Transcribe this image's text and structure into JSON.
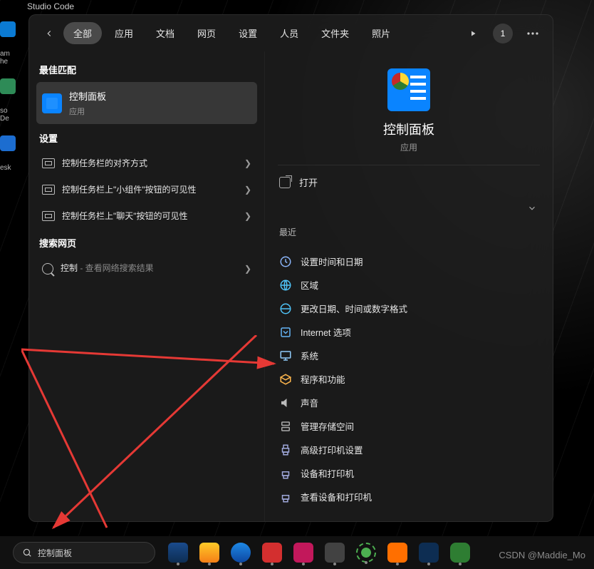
{
  "desktop": {
    "studio_code": "Studio Code"
  },
  "header": {
    "tabs": [
      "全部",
      "应用",
      "文档",
      "网页",
      "设置",
      "人员",
      "文件夹",
      "照片"
    ],
    "badge": "1"
  },
  "left": {
    "best_match_title": "最佳匹配",
    "best_match": {
      "title": "控制面板",
      "sub": "应用"
    },
    "settings_title": "设置",
    "settings": [
      "控制任务栏的对齐方式",
      "控制任务栏上\"小组件\"按钮的可见性",
      "控制任务栏上\"聊天\"按钮的可见性"
    ],
    "web_title": "搜索网页",
    "web_query": "控制",
    "web_suffix": " - 查看网络搜索结果"
  },
  "preview": {
    "title": "控制面板",
    "sub": "应用",
    "open_label": "打开",
    "recent_title": "最近",
    "recent": [
      "设置时间和日期",
      "区域",
      "更改日期、时间或数字格式",
      "Internet 选项",
      "系统",
      "程序和功能",
      "声音",
      "管理存储空间",
      "高级打印机设置",
      "设备和打印机",
      "查看设备和打印机"
    ]
  },
  "taskbar": {
    "search_value": "控制面板"
  },
  "watermark": "CSDN @Maddie_Mo"
}
